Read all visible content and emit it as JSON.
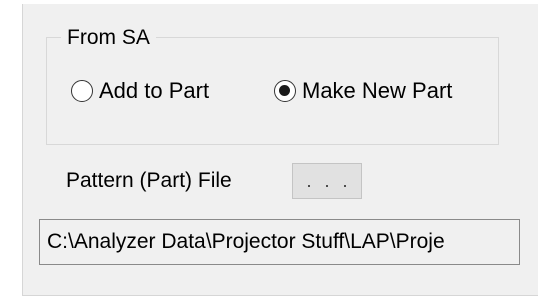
{
  "from_sa": {
    "title": "From SA",
    "options": [
      {
        "label": "Add to Part",
        "selected": false
      },
      {
        "label": "Make New Part",
        "selected": true
      }
    ]
  },
  "pattern_file": {
    "label": "Pattern (Part) File",
    "browse_label": ". . .",
    "path": "C:\\Analyzer Data\\Projector Stuff\\LAP\\Proje"
  }
}
